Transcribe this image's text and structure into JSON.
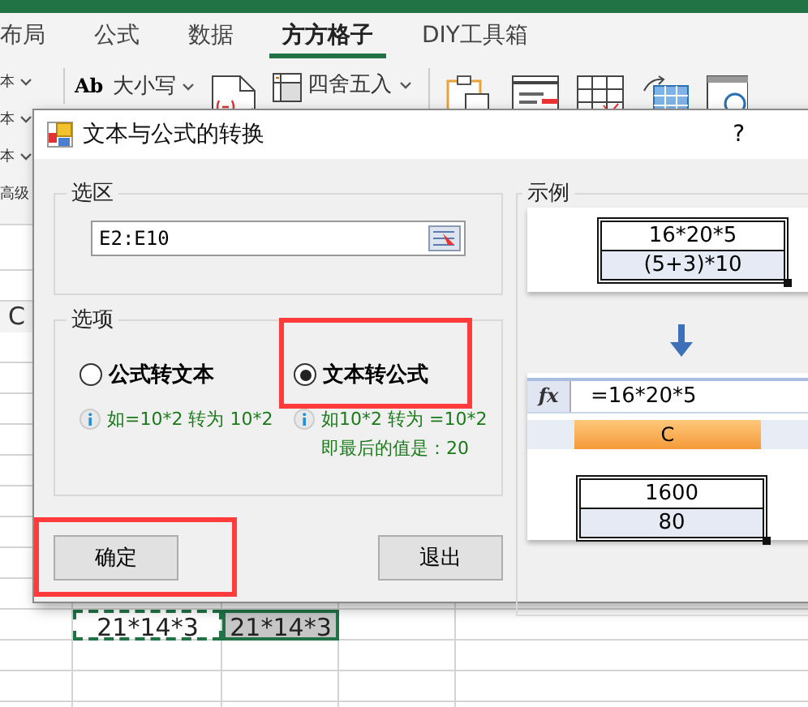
{
  "app": {
    "tabs": [
      {
        "label": "布局",
        "selected": false
      },
      {
        "label": "公式",
        "selected": false
      },
      {
        "label": "数据",
        "selected": false
      },
      {
        "label": "方方格子",
        "selected": true
      },
      {
        "label": "DIY工具箱",
        "selected": false
      }
    ],
    "ribbon": {
      "left_labels": [
        "本",
        "本",
        "本",
        "高级"
      ],
      "case_badge": "Ab",
      "case_label": "大小写",
      "round_label": "四舍五入"
    },
    "sheet": {
      "column_header": "C",
      "cells": [
        {
          "text": "21*14*3",
          "selected": false
        },
        {
          "text": "21*14*3",
          "selected": true
        }
      ]
    }
  },
  "dialog": {
    "title": "文本与公式的转换",
    "help": "?",
    "selection": {
      "label": "选区",
      "value": "E2:E10"
    },
    "options": {
      "label": "选项",
      "items": [
        {
          "label": "公式转文本",
          "selected": false,
          "highlighted": false,
          "hints": [
            "如=10*2 转为 10*2"
          ]
        },
        {
          "label": "文本转公式",
          "selected": true,
          "highlighted": true,
          "hints": [
            "如10*2 转为 =10*2",
            "即最后的值是：20"
          ]
        }
      ]
    },
    "buttons": [
      {
        "label": "确定",
        "highlighted": true
      },
      {
        "label": "退出",
        "highlighted": false
      }
    ],
    "example": {
      "label": "示例",
      "before": [
        "16*20*5",
        "(5+3)*10"
      ],
      "fx": "fx",
      "formula": "=16*20*5",
      "column": "C",
      "after": [
        "1600",
        "80"
      ]
    }
  }
}
